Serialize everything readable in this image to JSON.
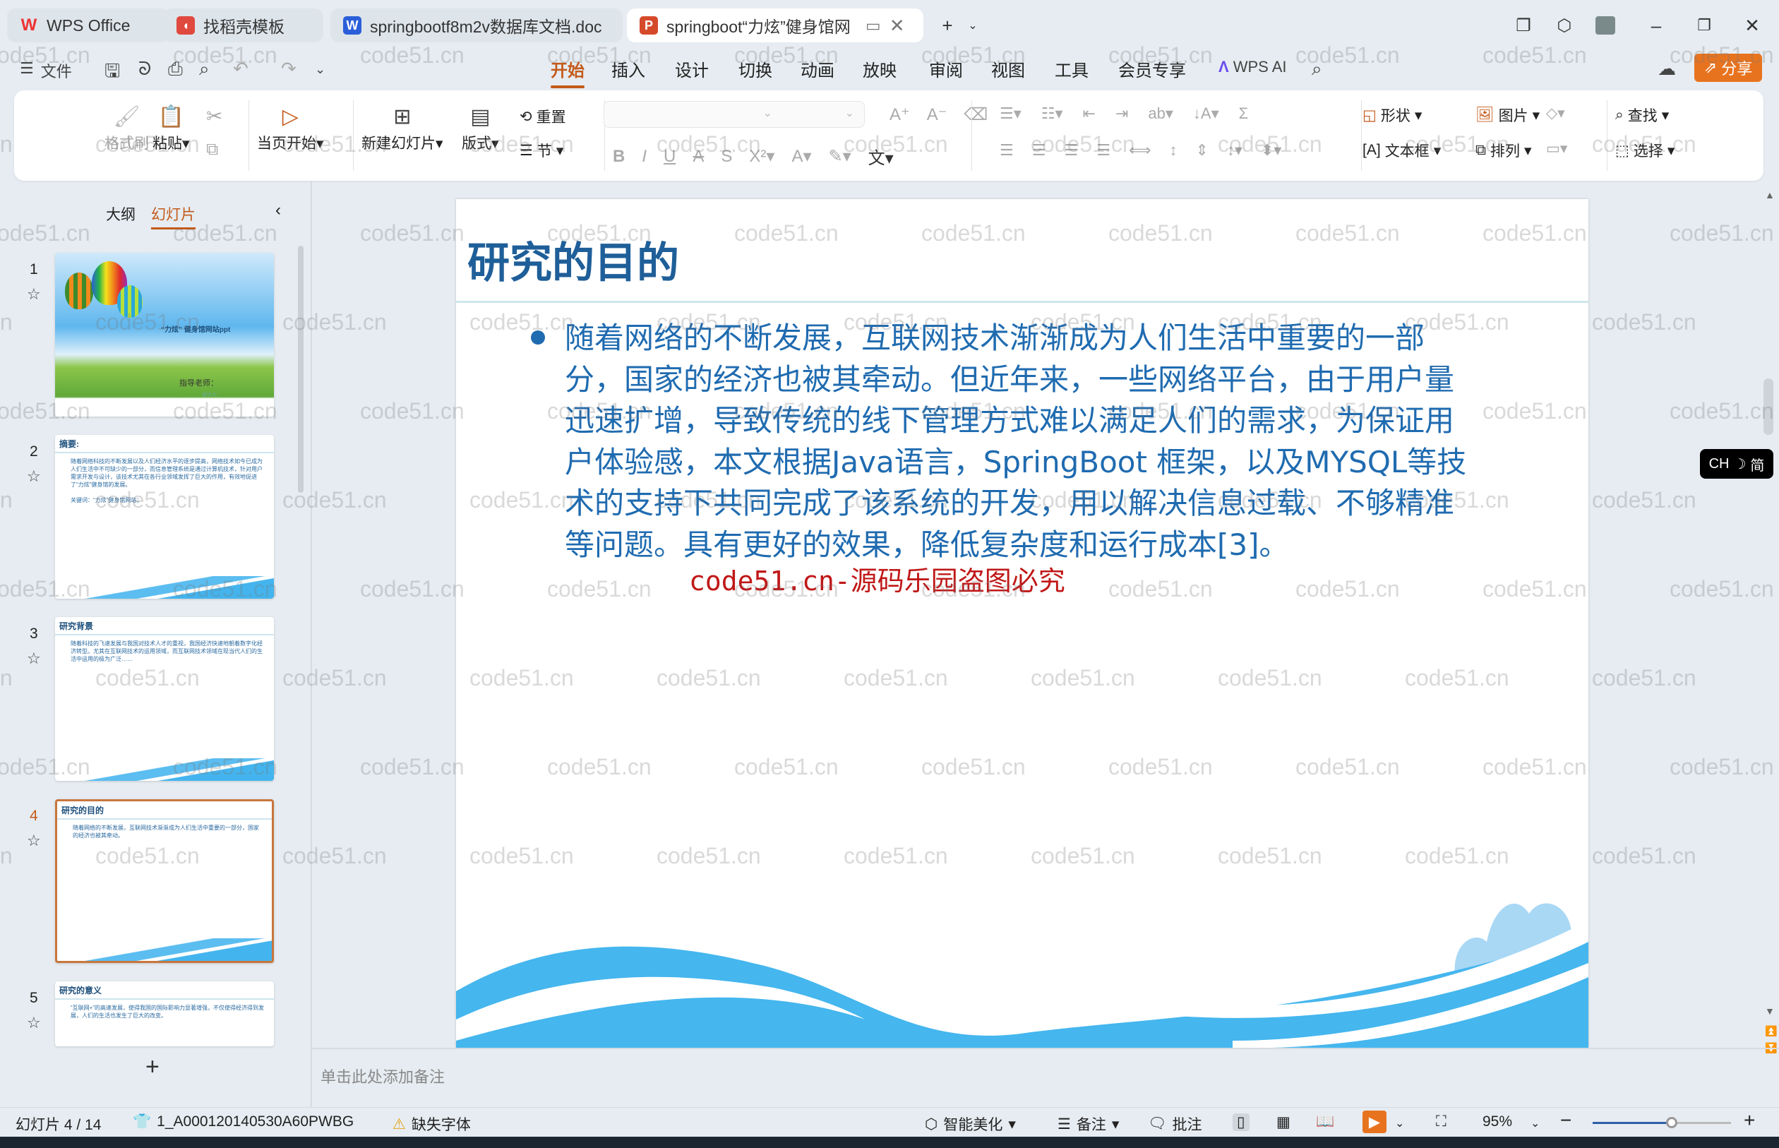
{
  "tabs": [
    {
      "label": "WPS Office",
      "icon": "wps-logo-icon"
    },
    {
      "label": "找稻壳模板",
      "icon": "docer-icon"
    },
    {
      "label": "springbootf8m2v数据库文档.doc",
      "icon": "word-doc-icon"
    },
    {
      "label": "springboot“力炫”健身馆网",
      "icon": "ppt-doc-icon",
      "active": true
    }
  ],
  "menu": {
    "file_label": "文件",
    "items": [
      "开始",
      "插入",
      "设计",
      "切换",
      "动画",
      "放映",
      "审阅",
      "视图",
      "工具",
      "会员专享"
    ],
    "active": "开始",
    "wps_ai_label": "WPS AI",
    "share_label": "分享"
  },
  "ribbon": {
    "format_painter": "格式刷",
    "paste": "粘贴",
    "play_from_current": "当页开始",
    "new_slide": "新建幻灯片",
    "layout": "版式",
    "reset": "重置",
    "section": "节",
    "font_name": "",
    "font_size": "",
    "shape": "形状",
    "picture": "图片",
    "textbox": "文本框",
    "arrange": "排列",
    "find": "查找",
    "select": "选择"
  },
  "left_panel": {
    "tab_outline": "大纲",
    "tab_slides": "幻灯片",
    "active_tab": "幻灯片",
    "thumbnails": [
      {
        "num": "1",
        "title": "“力炫” 健身馆网站ppt",
        "subtitle": "指导老师：",
        "designer": "设计人："
      },
      {
        "num": "2",
        "title": "摘要:",
        "body": "随着网络科技的不断发展以及人们经济水平的逐步提高，网络技术如今已成为人们生活中不可缺少的一部分，而信息管理系统是通过计算机技术，针对用户需求开发与设计，该技术尤其在各行业领域发挥了巨大的作用，有效地促进了“力炫”健身馆的发展。",
        "keywords": "关键词：“力炫”健身馆网站；"
      },
      {
        "num": "3",
        "title": "研究背景",
        "body": "随着科技的飞速发展与我国对技术人才的重视，我国经济快速地朝着数字化经济转型。尤其在互联网技术的运用领域，而互联网技术领域在现当代人们的生活中运用的极为广泛……"
      },
      {
        "num": "4",
        "title": "研究的目的",
        "body": "随着网络的不断发展，互联网技术渐渐成为人们生活中重要的一部分，国家的经济也被其牵动。",
        "selected": true
      },
      {
        "num": "5",
        "title": "研究的意义",
        "body": "“互联网+”的高速发展，使得我国的国际影响力显著增强，不仅使得经济得到发展，人们的生活也发生了巨大的改变。"
      }
    ]
  },
  "slide": {
    "title": "研究的目的",
    "body": "随着网络的不断发展，互联网技术渐渐成为人们生活中重要的一部分，国家的经济也被其牵动。但近年来，一些网络平台，由于用户量迅速扩增，导致传统的线下管理方式难以满足人们的需求，为保证用户体验感，本文根据Java语言，SpringBoot 框架，以及MYSQL等技术的支持下共同完成了该系统的开发，用以解决信息过载、不够精准等问题。具有更好的效果，降低复杂度和运行成本[3]。",
    "watermark_red": "code51.cn-源码乐园盗图必究"
  },
  "notes_placeholder": "单击此处添加备注",
  "ime": {
    "lang": "CH",
    "mode": "简"
  },
  "status": {
    "slide_counter": "幻灯片 4 / 14",
    "theme": "1_A000120140530A60PWBG",
    "missing_font": "缺失字体",
    "smart_beautify": "智能美化",
    "notes": "备注",
    "comment": "批注",
    "zoom": "95%",
    "zoom_fraction": 0.57
  },
  "watermark": "code51.cn",
  "colors": {
    "accent": "#c45a1a",
    "share": "#e8731f",
    "slide_text": "#1f6bb0"
  }
}
